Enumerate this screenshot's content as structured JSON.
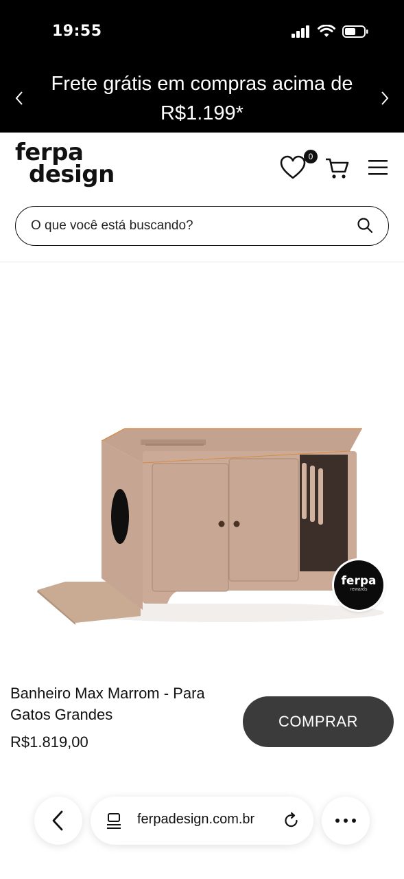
{
  "status_bar": {
    "time": "19:55"
  },
  "promo": {
    "text": "Frete grátis em compras acima de R$1.199*"
  },
  "header": {
    "logo_line1": "ferpa",
    "logo_line2": "design",
    "wishlist_count": "0",
    "icons": [
      "heart-icon",
      "cart-icon",
      "menu-icon"
    ]
  },
  "search": {
    "placeholder": "O que você está buscando?"
  },
  "product": {
    "name": "Banheiro Max Marrom - Para Gatos Grandes",
    "price": "R$1.819,00",
    "buy_label": "COMPRAR",
    "rewards_badge_line1": "ferpa",
    "rewards_badge_line2": "rewards"
  },
  "browser": {
    "url": "ferpadesign.com.br"
  },
  "colors": {
    "banner_bg": "#000000",
    "buy_button_bg": "#3b3b3b",
    "product_wood": "#c9a894"
  }
}
